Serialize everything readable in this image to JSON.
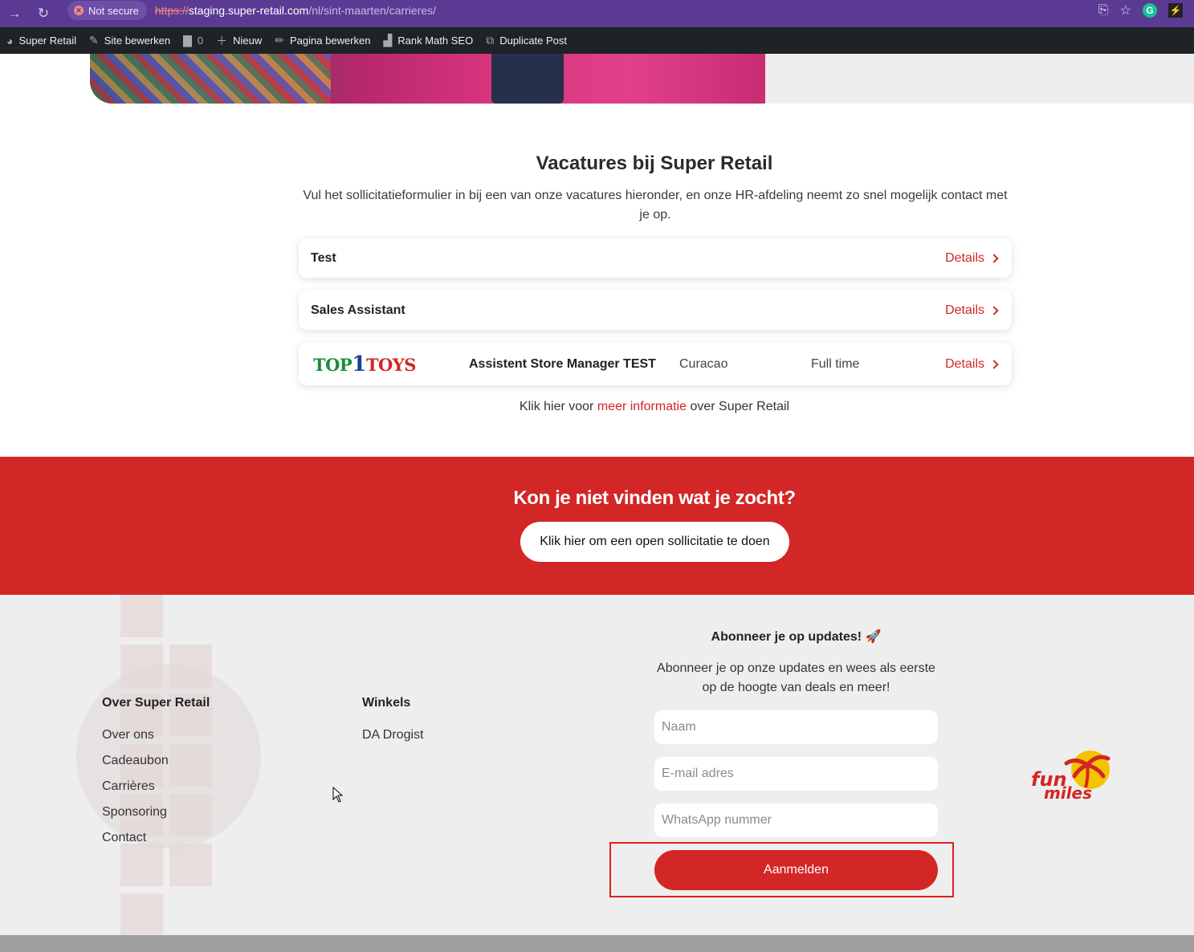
{
  "browser": {
    "security_label": "Not secure",
    "url_protocol": "https://",
    "url_host": "staging.super-retail.com",
    "url_path": "/nl/sint-maarten/carrieres/"
  },
  "admin_bar": {
    "site_name": "Super Retail",
    "edit_site": "Site bewerken",
    "comments_count": "0",
    "new": "Nieuw",
    "edit_page": "Pagina bewerken",
    "seo": "Rank Math SEO",
    "duplicate": "Duplicate Post"
  },
  "vacancies": {
    "title": "Vacatures bij Super Retail",
    "intro": "Vul het sollicitatieformulier in bij een van onze vacatures hieronder, en onze HR-afdeling neemt zo snel mogelijk contact met je op.",
    "details_label": "Details",
    "jobs": [
      {
        "title": "Test"
      },
      {
        "title": "Sales Assistant"
      },
      {
        "brand_logo": "TOP1TOYS",
        "title": "Assistent Store Manager TEST",
        "location": "Curacao",
        "type": "Full time"
      }
    ],
    "more_info_prefix": "Klik hier voor",
    "more_info_link": "meer informatie",
    "more_info_suffix": "over Super Retail"
  },
  "cta": {
    "title": "Kon je niet vinden wat je zocht?",
    "button": "Klik hier om een open sollicitatie te doen"
  },
  "footer": {
    "col1_title": "Over Super Retail",
    "col1_links": [
      "Over ons",
      "Cadeaubon",
      "Carrières",
      "Sponsoring",
      "Contact"
    ],
    "col2_title": "Winkels",
    "col2_links": [
      "DA Drogist"
    ],
    "subscribe": {
      "title": "Abonneer je op updates! 🚀",
      "text": "Abonneer je op onze updates en wees als eerste op de hoogte van deals en meer!",
      "name_placeholder": "Naam",
      "email_placeholder": "E-mail adres",
      "whatsapp_placeholder": "WhatsApp nummer",
      "submit": "Aanmelden"
    },
    "partner_logo": "fun miles"
  },
  "colors": {
    "brand_red": "#d32626",
    "browser_purple": "#5b3a94",
    "admin_bar": "#1d2327"
  }
}
